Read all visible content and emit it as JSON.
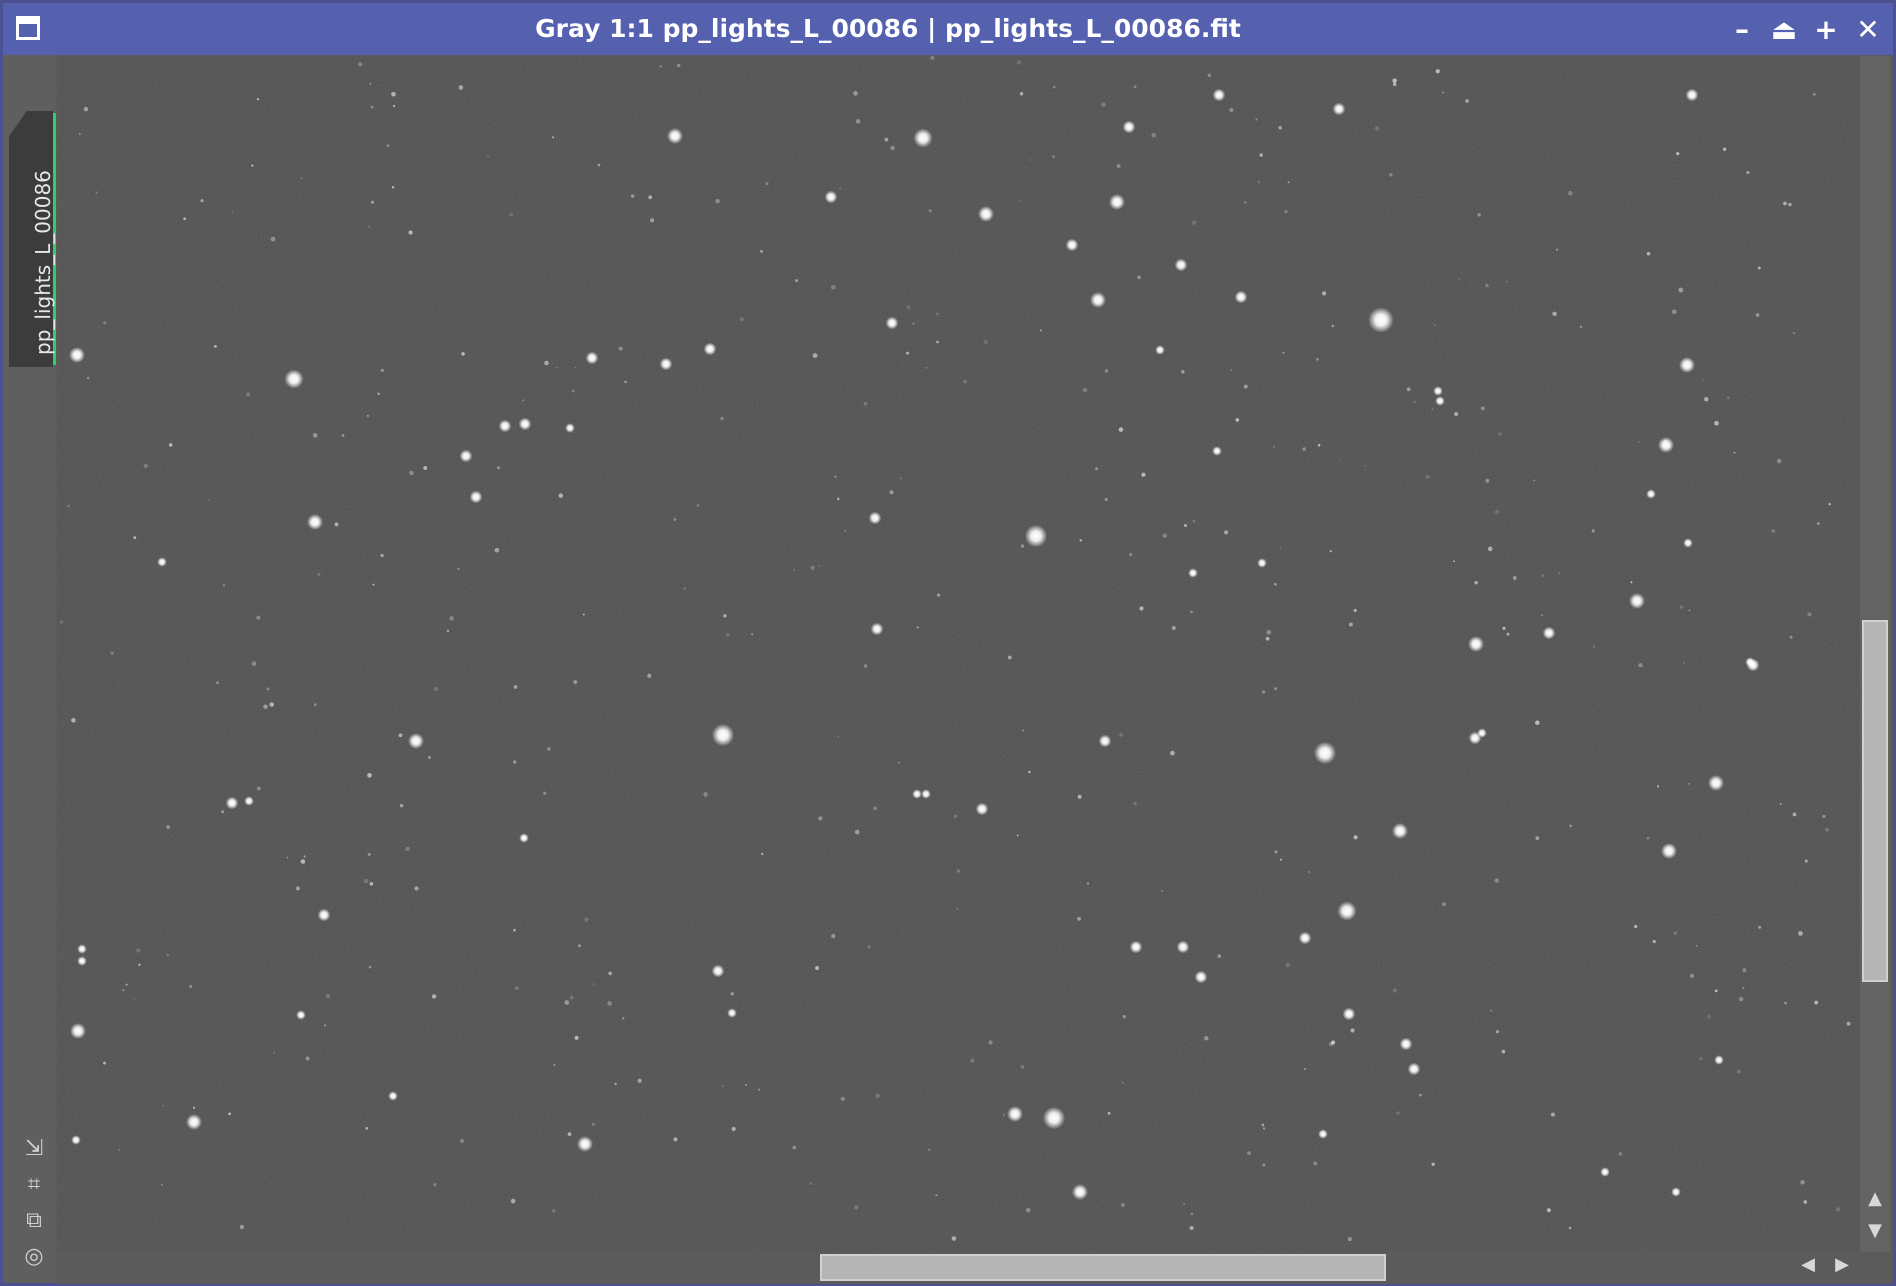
{
  "window": {
    "title": "Gray 1:1 pp_lights_L_00086 | pp_lights_L_00086.fit",
    "icon": "window-icon",
    "buttons": [
      {
        "name": "minimize-button",
        "glyph": "–",
        "icon": "minimize-icon"
      },
      {
        "name": "shade-button",
        "glyph": "⏏",
        "icon": "shade-icon"
      },
      {
        "name": "maximize-button",
        "glyph": "+",
        "icon": "maximize-icon"
      },
      {
        "name": "close-button",
        "glyph": "✕",
        "icon": "close-icon"
      }
    ]
  },
  "sidebar": {
    "tab_label": "pp_lights_L_00086",
    "tools": [
      {
        "name": "fit-view-tool",
        "glyph": "⇲",
        "icon": "fit-view-icon"
      },
      {
        "name": "zoom-to-fit-tool",
        "glyph": "⌗",
        "icon": "zoom-fit-icon"
      },
      {
        "name": "clone-tool",
        "glyph": "⧉",
        "icon": "clone-icon"
      },
      {
        "name": "target-tool",
        "glyph": "◎",
        "icon": "target-icon"
      }
    ]
  },
  "image": {
    "mode": "Gray",
    "zoom": "1:1",
    "background_color": "#4c4c4c",
    "star_color": "#ffffff"
  },
  "scrollbars": {
    "vertical": {
      "position_fraction": 0.43,
      "visible_fraction": 0.3
    },
    "horizontal": {
      "position_fraction": 0.41,
      "visible_fraction": 0.31
    },
    "arrows": {
      "up": "▲",
      "down": "▼",
      "left": "◀",
      "right": "▶"
    }
  }
}
